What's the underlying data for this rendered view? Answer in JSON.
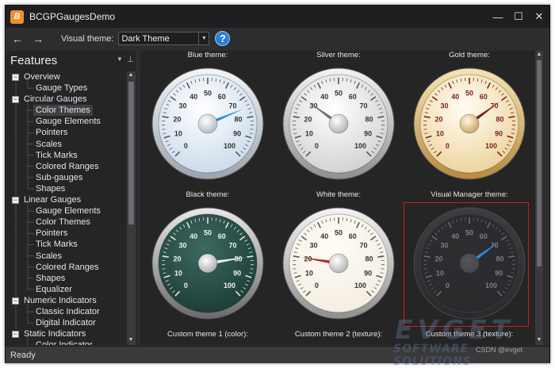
{
  "window": {
    "title": "BCGPGaugesDemo",
    "app_icon_letter": "B",
    "min_glyph": "—",
    "max_glyph": "☐",
    "close_glyph": "✕"
  },
  "toolbar": {
    "back_glyph": "←",
    "forward_glyph": "→",
    "visual_theme_label": "Visual theme:",
    "theme_value": "Dark Theme",
    "help_glyph": "?"
  },
  "sidebar": {
    "title": "Features",
    "tree": [
      {
        "label": "Overview",
        "level": 0
      },
      {
        "label": "Gauge Types",
        "level": 1
      },
      {
        "label": "Circular Gauges",
        "level": 0
      },
      {
        "label": "Color Themes",
        "level": 1,
        "selected": true
      },
      {
        "label": "Gauge Elements",
        "level": 1
      },
      {
        "label": "Pointers",
        "level": 1
      },
      {
        "label": "Scales",
        "level": 1
      },
      {
        "label": "Tick Marks",
        "level": 1
      },
      {
        "label": "Colored Ranges",
        "level": 1
      },
      {
        "label": "Sub-gauges",
        "level": 1
      },
      {
        "label": "Shapes",
        "level": 1
      },
      {
        "label": "Linear Gauges",
        "level": 0
      },
      {
        "label": "Gauge Elements",
        "level": 1
      },
      {
        "label": "Color Themes",
        "level": 1
      },
      {
        "label": "Pointers",
        "level": 1
      },
      {
        "label": "Tick Marks",
        "level": 1
      },
      {
        "label": "Scales",
        "level": 1
      },
      {
        "label": "Colored Ranges",
        "level": 1
      },
      {
        "label": "Shapes",
        "level": 1
      },
      {
        "label": "Equalizer",
        "level": 1
      },
      {
        "label": "Numeric Indicators",
        "level": 0
      },
      {
        "label": "Classic Indicator",
        "level": 1
      },
      {
        "label": "Digital Indicator",
        "level": 1
      },
      {
        "label": "Static Indicators",
        "level": 0
      },
      {
        "label": "Color Indicator",
        "level": 1
      }
    ]
  },
  "gauges": [
    {
      "caption": "Blue theme:",
      "value": 75,
      "theme": "blue"
    },
    {
      "caption": "Silver theme:",
      "value": 30,
      "theme": "silver"
    },
    {
      "caption": "Gold theme:",
      "value": 70,
      "theme": "gold"
    },
    {
      "caption": "Black theme:",
      "value": 80,
      "theme": "black"
    },
    {
      "caption": "White theme:",
      "value": 20,
      "theme": "white"
    },
    {
      "caption": "Visual Manager theme:",
      "value": 70,
      "theme": "vm"
    }
  ],
  "scale_labels": [
    "0",
    "10",
    "20",
    "30",
    "40",
    "50",
    "60",
    "70",
    "80",
    "90",
    "100"
  ],
  "bottom_captions": [
    "Custom theme 1 (color):",
    "Custom theme 2 (texture):",
    "Custom theme 3 (texture):"
  ],
  "status": {
    "text": "Ready"
  },
  "watermark": {
    "line1": "EVGET",
    "line2": "SOFTWARE SOLUTIONS",
    "line3": "CSDN @evget"
  },
  "colors": {
    "selection_frame": "#c81e1e",
    "blue_needle": "#2a8fe0",
    "silver_needle": "#707070",
    "gold_needle": "#7a1f1f",
    "black_needle": "#f0f0f0",
    "white_needle": "#c62828",
    "vm_needle": "#2a8fe0"
  }
}
